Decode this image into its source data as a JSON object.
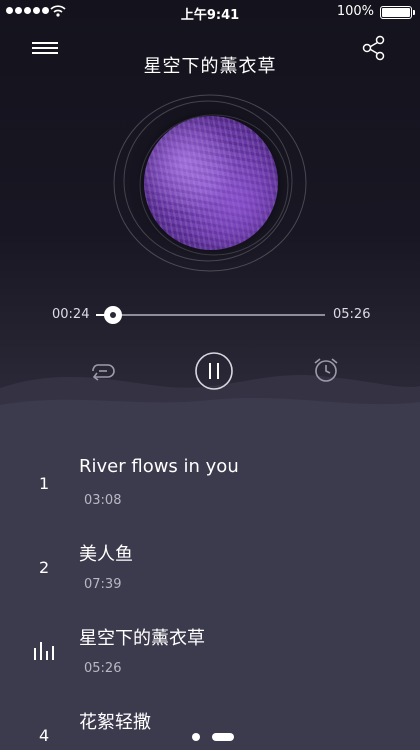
{
  "status_bar": {
    "time": "上午9:41",
    "battery": "100%"
  },
  "player": {
    "now_playing_title": "星空下的薰衣草",
    "elapsed": "00:24",
    "total": "05:26",
    "progress": 0.075
  },
  "controls": {
    "icons": [
      "repeat-icon",
      "pause-icon",
      "alarm-clock-icon"
    ]
  },
  "playlist": [
    {
      "index": "1",
      "name": "River flows in you",
      "duration": "03:08"
    },
    {
      "index": "2",
      "name": "美人鱼",
      "duration": "07:39"
    },
    {
      "index": "",
      "name": "星空下的薰衣草",
      "duration": "05:26",
      "playing": true
    },
    {
      "index": "4",
      "name": "花絮轻撒",
      "duration": ""
    }
  ],
  "pager": {
    "pages": 2,
    "current": 2
  },
  "colors": {
    "background": "#3c3a4d",
    "hero_top": "#14131d",
    "accent": "#ffffff",
    "muted_text": "#b9b8c4"
  }
}
